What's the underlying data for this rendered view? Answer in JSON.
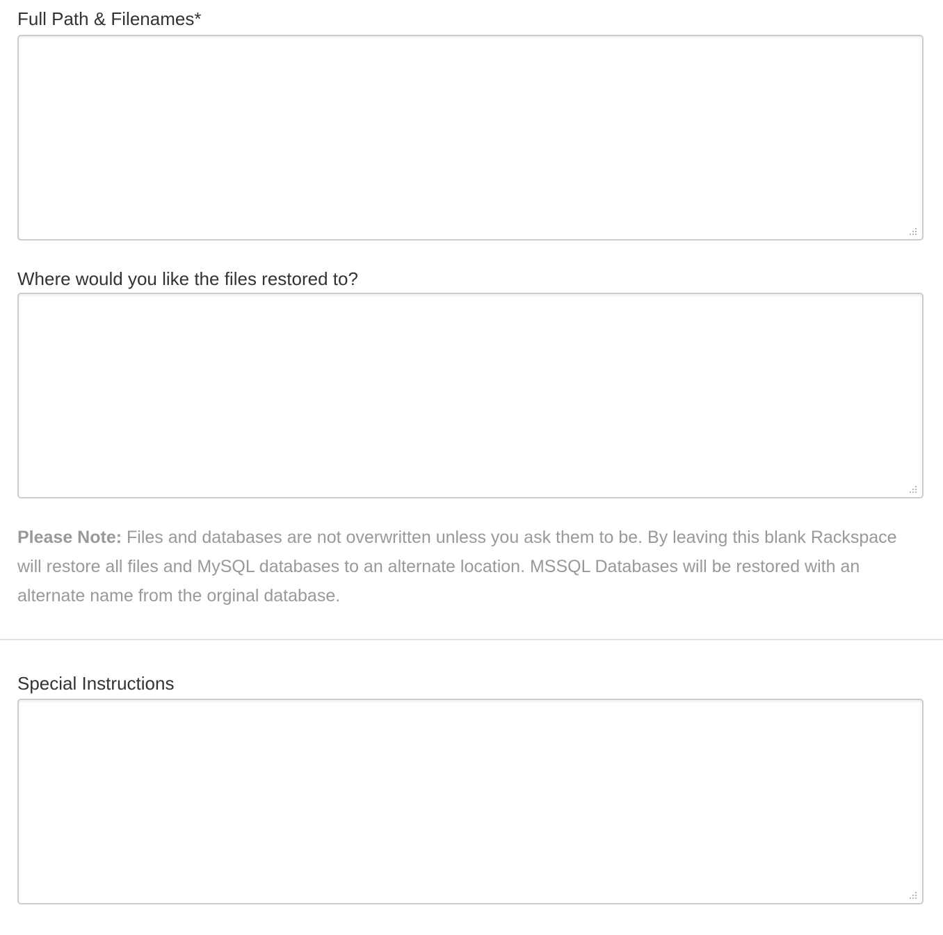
{
  "form": {
    "fields": [
      {
        "label": "Full Path & Filenames*",
        "value": ""
      },
      {
        "label": "Where would you like the files restored to?",
        "value": ""
      },
      {
        "label": "Special Instructions",
        "value": ""
      }
    ],
    "note": {
      "prefix": "Please Note:",
      "text": " Files and databases are not overwritten unless you ask them to be. By leaving this blank Rackspace will restore all files and MySQL databases to an alternate location. MSSQL Databases will be restored with an alternate name from the orginal database."
    }
  },
  "colors": {
    "label_text": "#333333",
    "note_text": "#999999",
    "border": "#cccccc",
    "divider": "#e2e2e2"
  },
  "icons": {
    "resize_grip": "resize-grip-icon"
  }
}
